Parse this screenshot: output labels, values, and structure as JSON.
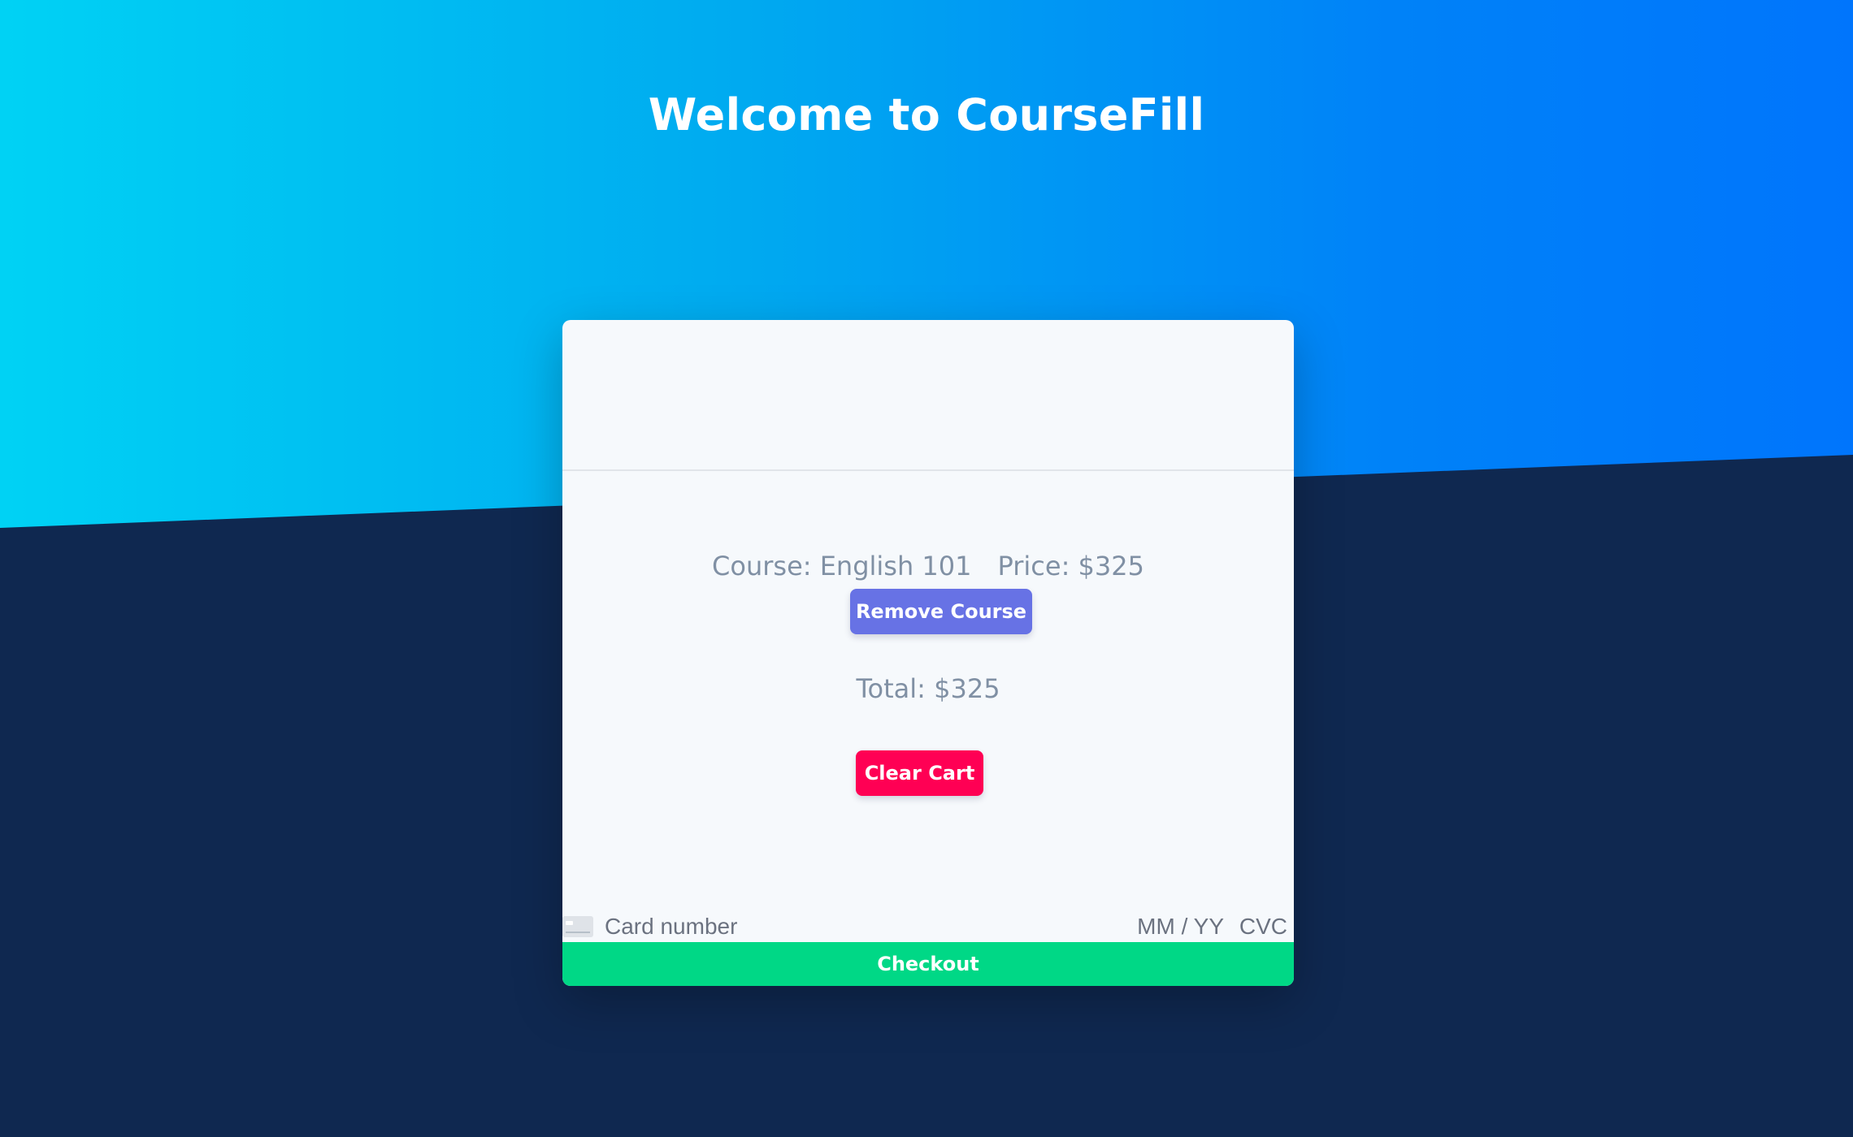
{
  "header": {
    "title": "Welcome to CourseFill"
  },
  "cart": {
    "course_label": "Course: English 101",
    "price_label": "Price: $325",
    "remove_label": "Remove Course",
    "total_label": "Total: $325",
    "clear_label": "Clear Cart"
  },
  "payment": {
    "card_number_placeholder": "Card number",
    "expiry_placeholder": "MM / YY",
    "cvc_placeholder": "CVC",
    "checkout_label": "Checkout"
  },
  "colors": {
    "gradient_start": "#00d2f4",
    "gradient_end": "#0075fc",
    "background_dark": "#0f2850",
    "card_bg": "#f6f9fc",
    "remove_button": "#6772e5",
    "clear_button": "#ff0054",
    "checkout_button": "#00d886"
  },
  "icons": {
    "card_brand": "credit-card-icon"
  }
}
